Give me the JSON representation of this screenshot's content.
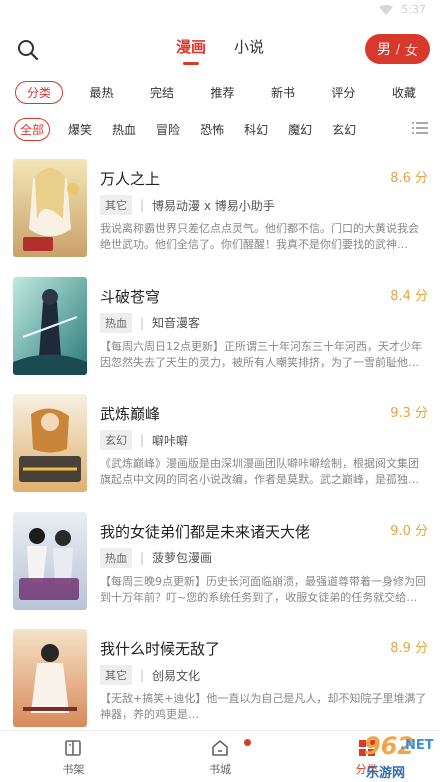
{
  "status": {
    "time": "5:37"
  },
  "header": {
    "tabs": [
      {
        "label": "漫画",
        "active": true
      },
      {
        "label": "小说",
        "active": false
      }
    ],
    "gender": {
      "active": "男",
      "separator": "/",
      "inactive": "女"
    }
  },
  "sort": [
    "分类",
    "最热",
    "完结",
    "推荐",
    "新书",
    "评分",
    "收藏"
  ],
  "genres": [
    "全部",
    "爆笑",
    "热血",
    "冒险",
    "恐怖",
    "科幻",
    "魔幻",
    "玄幻"
  ],
  "colors": {
    "accent": "#d8392c",
    "score": "#e8a33d"
  },
  "items": [
    {
      "title": "万人之上",
      "score": "8.6 分",
      "tag": "其它",
      "author": "博易动漫 x 博易小助手",
      "desc": "我说离称霸世界只差亿点点灵气。他们都不信。门口的大黄说我会绝世武功。他们全信了。你们醒醒！我真不是你们要找的武神…"
    },
    {
      "title": "斗破苍穹",
      "score": "8.4 分",
      "tag": "热血",
      "author": "知音漫客",
      "desc": "【每周六周日12点更新】正所谓三十年河东三十年河西，天才少年因忽然失去了天生的灵力，被所有人嘲笑排挤，为了一雪前耻他…"
    },
    {
      "title": "武炼巅峰",
      "score": "9.3 分",
      "tag": "玄幻",
      "author": "噼咔噼",
      "desc": "《武炼巅峰》漫画版是由深圳漫画团队噼咔噼绘制，根据阅文集团旗起点中文网的同名小说改编，作者是莫默。武之巅峰，是孤独…"
    },
    {
      "title": "我的女徒弟们都是未来诸天大佬",
      "score": "9.0 分",
      "tag": "热血",
      "author": "菠萝包漫画",
      "desc": "【每周三晚9点更新】历史长河面临崩溃，最强道尊带着一身修为回到十万年前？叮~您的系统任务到了，收服女徒弟的任务就交给…"
    },
    {
      "title": "我什么时候无敌了",
      "score": "8.9 分",
      "tag": "其它",
      "author": "创易文化",
      "desc": "【无敌+搞笑+迪化】他一直以为自己是凡人，却不知院子里堆满了神器，养的鸡更是…"
    }
  ],
  "bottom_nav": [
    {
      "label": "书架",
      "icon": "bookshelf-icon",
      "active": false
    },
    {
      "label": "书城",
      "icon": "bookstore-icon",
      "active": false,
      "badge": true
    },
    {
      "label": "分类",
      "icon": "category-icon",
      "active": true
    }
  ],
  "watermark": {
    "num": "962",
    "net": ".NET",
    "cn": "乐游网"
  }
}
